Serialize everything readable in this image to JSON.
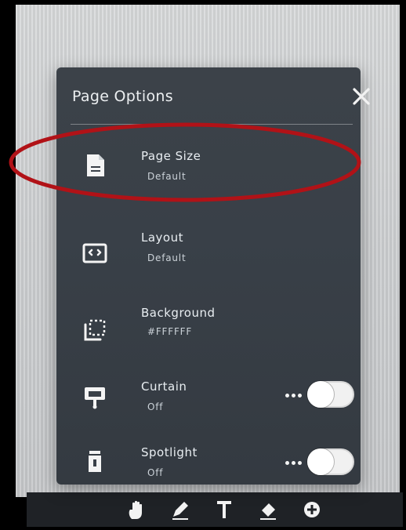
{
  "panel": {
    "title": "Page Options",
    "items": [
      {
        "label": "Page Size",
        "value": "Default",
        "icon": "document-icon"
      },
      {
        "label": "Layout",
        "value": "Default",
        "icon": "layout-icon"
      },
      {
        "label": "Background",
        "value": "#FFFFFF",
        "icon": "background-icon"
      },
      {
        "label": "Curtain",
        "value": "Off",
        "icon": "curtain-icon"
      },
      {
        "label": "Spotlight",
        "value": "Off",
        "icon": "spotlight-icon"
      }
    ]
  },
  "colors": {
    "panel": "#3a4048",
    "annotation": "#b11217"
  },
  "toolbar": {
    "tools": [
      "hand-tool-icon",
      "pen-tool-icon",
      "text-tool-icon",
      "eraser-tool-icon",
      "add-tool-icon"
    ]
  }
}
